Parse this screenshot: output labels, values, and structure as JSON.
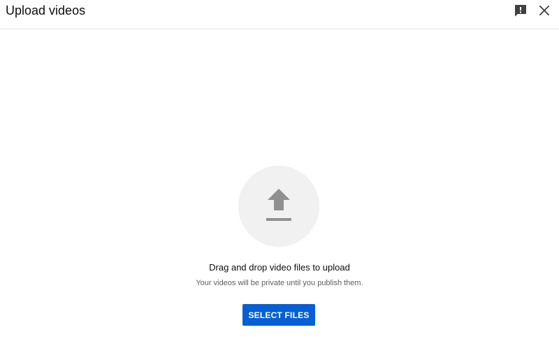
{
  "dialog": {
    "title": "Upload videos"
  },
  "header": {
    "feedback_icon": "feedback-icon",
    "close_icon": "close-icon"
  },
  "upload": {
    "icon": "upload-arrow-icon",
    "drag_text": "Drag and drop video files to upload",
    "privacy_text": "Your videos will be private until you publish them.",
    "select_label": "SELECT FILES"
  },
  "colors": {
    "accent": "#065fd4",
    "icon_gray": "#909090",
    "circle_bg": "#f1f1f1"
  }
}
